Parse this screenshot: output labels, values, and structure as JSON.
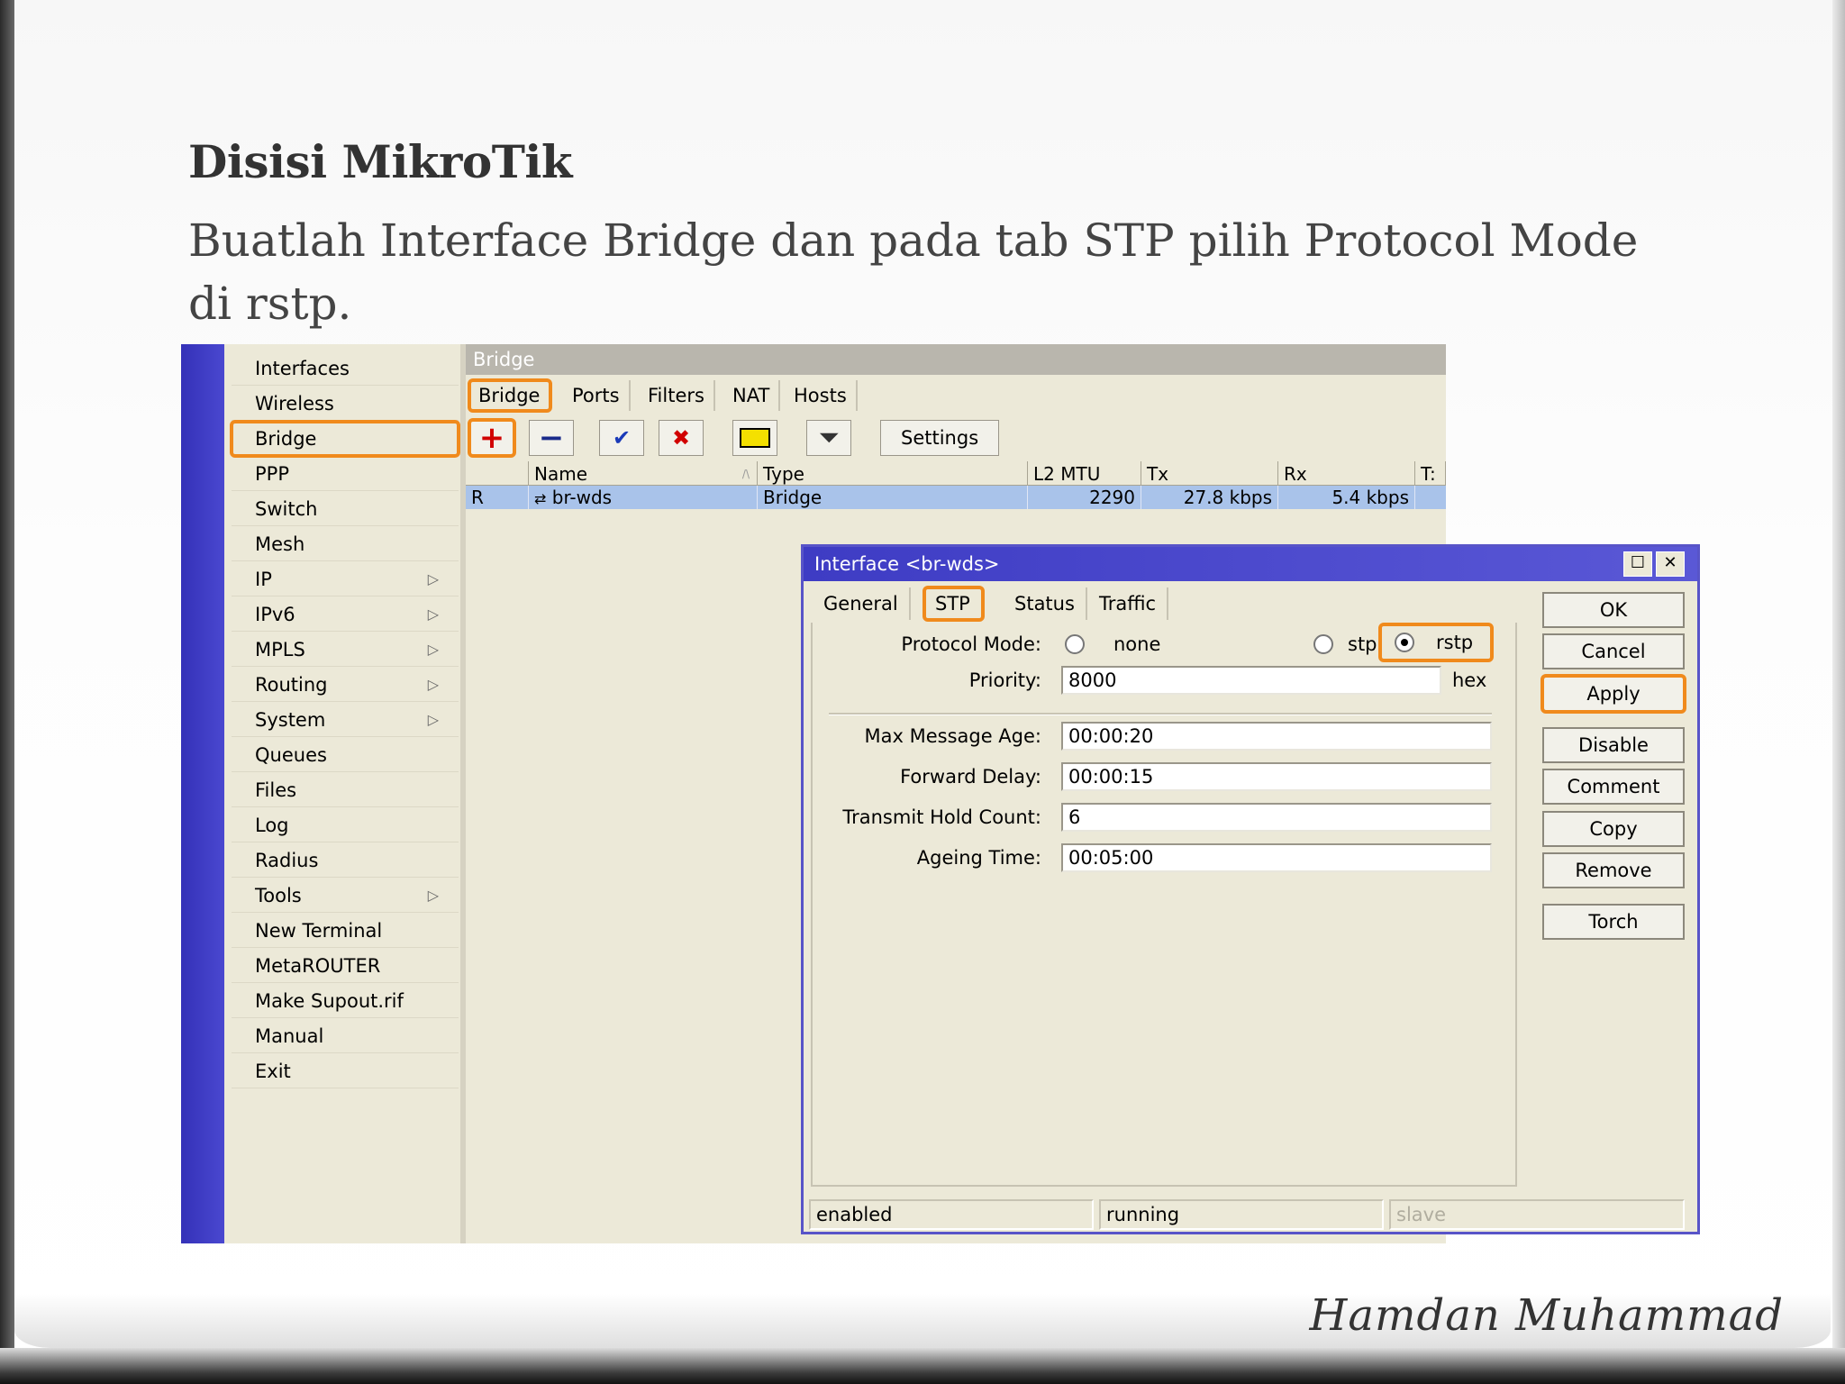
{
  "slide": {
    "title": "Disisi MikroTik",
    "subtitle": "Buatlah Interface Bridge dan pada tab STP pilih Protocol Mode di rstp.",
    "signature": "Hamdan Muhammad"
  },
  "menu": {
    "items": [
      {
        "label": "Interfaces"
      },
      {
        "label": "Wireless"
      },
      {
        "label": "Bridge"
      },
      {
        "label": "PPP"
      },
      {
        "label": "Switch"
      },
      {
        "label": "Mesh"
      },
      {
        "label": "IP"
      },
      {
        "label": "IPv6"
      },
      {
        "label": "MPLS"
      },
      {
        "label": "Routing"
      },
      {
        "label": "System"
      },
      {
        "label": "Queues"
      },
      {
        "label": "Files"
      },
      {
        "label": "Log"
      },
      {
        "label": "Radius"
      },
      {
        "label": "Tools"
      },
      {
        "label": "New Terminal"
      },
      {
        "label": "MetaROUTER"
      },
      {
        "label": "Make Supout.rif"
      },
      {
        "label": "Manual"
      },
      {
        "label": "Exit"
      }
    ],
    "submenu_arrow": "▷"
  },
  "bridge_window": {
    "title": "Bridge",
    "tabs": [
      "Bridge",
      "Ports",
      "Filters",
      "NAT",
      "Hosts"
    ],
    "toolbar": {
      "settings_label": "Settings"
    },
    "columns": [
      "Name",
      "Type",
      "L2 MTU",
      "Tx",
      "Rx",
      "T:"
    ],
    "sort_indicator": "/\\",
    "rows": [
      {
        "flag": "R",
        "name": "br-wds",
        "type": "Bridge",
        "l2mtu": "2290",
        "tx": "27.8 kbps",
        "rx": "5.4 kbps"
      }
    ]
  },
  "dialog": {
    "title": "Interface <br-wds>",
    "tabs": [
      "General",
      "STP",
      "Status",
      "Traffic"
    ],
    "protocol_mode_label": "Protocol Mode:",
    "protocol_options": [
      "none",
      "stp",
      "rstp"
    ],
    "protocol_selected": "rstp",
    "priority_label": "Priority:",
    "priority_value": "8000",
    "priority_suffix": "hex",
    "max_message_age_label": "Max Message Age:",
    "max_message_age_value": "00:00:20",
    "forward_delay_label": "Forward Delay:",
    "forward_delay_value": "00:00:15",
    "transmit_hold_count_label": "Transmit Hold Count:",
    "transmit_hold_count_value": "6",
    "ageing_time_label": "Ageing Time:",
    "ageing_time_value": "00:05:00",
    "buttons": {
      "ok": "OK",
      "cancel": "Cancel",
      "apply": "Apply",
      "disable": "Disable",
      "comment": "Comment",
      "copy": "Copy",
      "remove": "Remove",
      "torch": "Torch"
    },
    "status": [
      "enabled",
      "running",
      "slave"
    ]
  },
  "colors": {
    "highlight": "#f08a1c",
    "titlebar": "#3e3cc4",
    "selected_row": "#a9c3ea",
    "window_bg": "#ece9d8"
  }
}
